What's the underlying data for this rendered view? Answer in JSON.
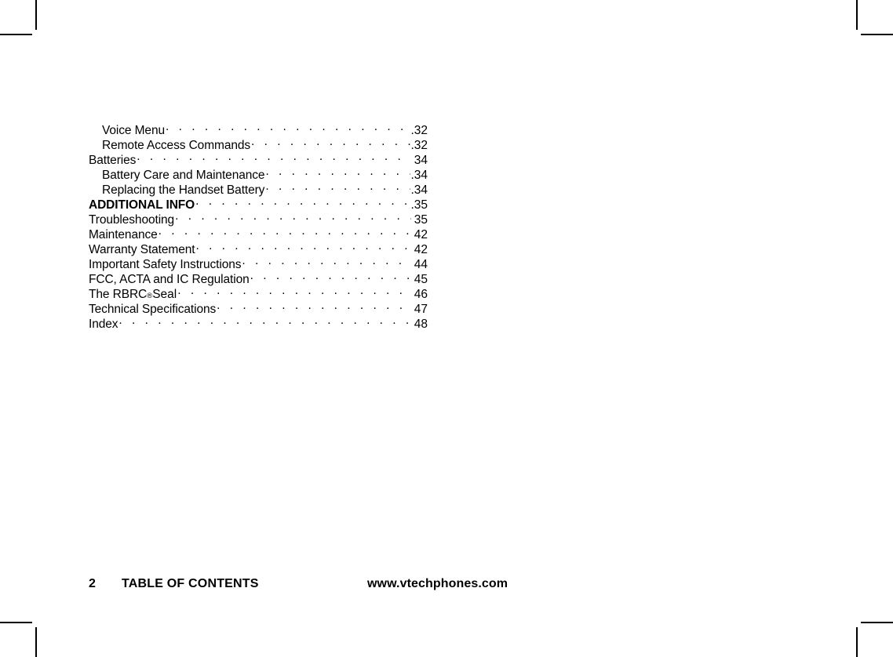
{
  "document": {
    "page_number": "2",
    "section_title": "TABLE OF CONTENTS",
    "website": "www.vtechphones.com"
  },
  "toc": {
    "entries": [
      {
        "title": "Voice Menu",
        "page": "32",
        "level": 1,
        "bold": false,
        "tight": true,
        "reg_mark": false
      },
      {
        "title": "Remote Access Commands",
        "page": "32",
        "level": 1,
        "bold": false,
        "tight": true,
        "reg_mark": false
      },
      {
        "title": "Batteries",
        "page": "34",
        "level": 0,
        "bold": false,
        "tight": false,
        "reg_mark": false
      },
      {
        "title": "Battery Care and Maintenance",
        "page": "34",
        "level": 1,
        "bold": false,
        "tight": true,
        "reg_mark": false
      },
      {
        "title": "Replacing the Handset Battery",
        "page": "34",
        "level": 1,
        "bold": false,
        "tight": true,
        "reg_mark": false
      },
      {
        "title": "ADDITIONAL INFO",
        "page": "35",
        "level": 0,
        "bold": true,
        "tight": true,
        "reg_mark": false
      },
      {
        "title": "Troubleshooting",
        "page": "35",
        "level": 0,
        "bold": false,
        "tight": false,
        "reg_mark": false
      },
      {
        "title": "Maintenance",
        "page": "42",
        "level": 0,
        "bold": false,
        "tight": false,
        "reg_mark": false
      },
      {
        "title": "Warranty Statement",
        "page": "42",
        "level": 0,
        "bold": false,
        "tight": false,
        "reg_mark": false
      },
      {
        "title": "Important Safety Instructions",
        "page": "44",
        "level": 0,
        "bold": false,
        "tight": false,
        "reg_mark": false
      },
      {
        "title": "FCC, ACTA and IC Regulation",
        "page": "45",
        "level": 0,
        "bold": false,
        "tight": false,
        "reg_mark": false
      },
      {
        "title": "The RBRC",
        "title_suffix": " Seal",
        "page": "46",
        "level": 0,
        "bold": false,
        "tight": false,
        "reg_mark": true
      },
      {
        "title": "Technical Specifications",
        "page": "47",
        "level": 0,
        "bold": false,
        "tight": false,
        "reg_mark": false
      },
      {
        "title": "Index",
        "page": "48",
        "level": 0,
        "bold": false,
        "tight": false,
        "reg_mark": false
      }
    ]
  },
  "colors": {
    "text": "#000000",
    "background": "#ffffff",
    "crop_marks": "#000000"
  }
}
